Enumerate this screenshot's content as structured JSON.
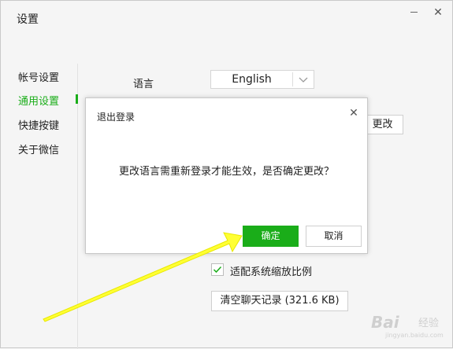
{
  "window": {
    "title": "设置"
  },
  "sidebar": {
    "items": [
      {
        "label": "帐号设置",
        "active": false
      },
      {
        "label": "通用设置",
        "active": true
      },
      {
        "label": "快捷按键",
        "active": false
      },
      {
        "label": "关于微信",
        "active": false
      }
    ]
  },
  "general": {
    "language_label": "语言",
    "language_value": "English",
    "change_button_partial": "更改",
    "scale_checkbox_label": "适配系统缩放比例",
    "scale_checkbox_checked": true,
    "clear_history_button": "清空聊天记录 (321.6 KB)"
  },
  "dialog": {
    "title": "退出登录",
    "message": "更改语言需重新登录才能生效，是否确定更改？",
    "confirm_label": "确定",
    "cancel_label": "取消"
  },
  "watermark": {
    "brand": "Bai",
    "suffix": "经验",
    "url": "jingyan.baidu.com"
  },
  "colors": {
    "accent": "#1aad19",
    "arrow": "#ffff33"
  },
  "icons": {
    "close": "close-icon",
    "minimize": "minimize-icon",
    "dropdown": "chevron-down-icon",
    "check": "check-icon"
  }
}
